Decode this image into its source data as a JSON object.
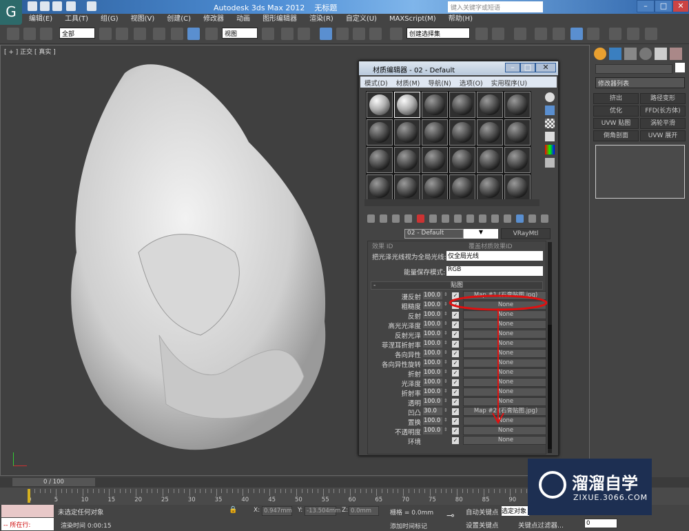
{
  "app": {
    "title": "Autodesk 3ds Max  2012",
    "doc": "无标题",
    "search_placeholder": "键入关键字或短语"
  },
  "menu": [
    "编辑(E)",
    "工具(T)",
    "组(G)",
    "视图(V)",
    "创建(C)",
    "修改器",
    "动画",
    "图形编辑器",
    "渲染(R)",
    "自定义(U)",
    "MAXScript(M)",
    "帮助(H)"
  ],
  "toolbar": {
    "selection_filter": "全部",
    "ref_coord": "视图",
    "named_selection": "创建选择集"
  },
  "viewport": {
    "label": "[ + ] 正交 [ 真实 ]"
  },
  "command_panel": {
    "modifier_list": "修改器列表",
    "buttons": [
      "挤出",
      "路径变形",
      "优化",
      "FFD(长方体)",
      "UVW 贴图",
      "涡轮平滑",
      "倒角剖面",
      "UVW 展开"
    ]
  },
  "material_editor": {
    "title": "材质编辑器 - 02 - Default",
    "menu": [
      "模式(D)",
      "材质(M)",
      "导航(N)",
      "选项(O)",
      "实用程序(U)"
    ],
    "material_name": "02 - Default",
    "material_type": "VRayMtl",
    "effect_id_label": "效果 ID",
    "override_label": "覆盖材质效果ID",
    "gi_label": "把光泽光线视为全局光线:",
    "gi_value": "仅全局光线",
    "energy_label": "能量保存模式:",
    "energy_value": "RGB",
    "maps_rollout": "贴图",
    "maps": [
      {
        "label": "漫反射",
        "amount": "100.0",
        "checked": true,
        "map": "Map #1 (石膏贴图.jpg)"
      },
      {
        "label": "粗糙度",
        "amount": "100.0",
        "checked": true,
        "map": "None"
      },
      {
        "label": "反射",
        "amount": "100.0",
        "checked": true,
        "map": "None"
      },
      {
        "label": "高光光泽度",
        "amount": "100.0",
        "checked": true,
        "map": "None"
      },
      {
        "label": "反射光泽",
        "amount": "100.0",
        "checked": true,
        "map": "None"
      },
      {
        "label": "菲涅耳折射率",
        "amount": "100.0",
        "checked": true,
        "map": "None"
      },
      {
        "label": "各向异性",
        "amount": "100.0",
        "checked": true,
        "map": "None"
      },
      {
        "label": "各向异性旋转",
        "amount": "100.0",
        "checked": true,
        "map": "None"
      },
      {
        "label": "折射",
        "amount": "100.0",
        "checked": true,
        "map": "None"
      },
      {
        "label": "光泽度",
        "amount": "100.0",
        "checked": true,
        "map": "None"
      },
      {
        "label": "折射率",
        "amount": "100.0",
        "checked": true,
        "map": "None"
      },
      {
        "label": "透明",
        "amount": "100.0",
        "checked": true,
        "map": "None"
      },
      {
        "label": "凹凸",
        "amount": "30.0",
        "checked": true,
        "map": "Map #2 (石膏贴图.jpg)"
      },
      {
        "label": "置换",
        "amount": "100.0",
        "checked": true,
        "map": "None"
      },
      {
        "label": "不透明度",
        "amount": "100.0",
        "checked": true,
        "map": "None"
      },
      {
        "label": "环境",
        "amount": "",
        "checked": true,
        "map": "None"
      }
    ],
    "annotation_color": "#e01010"
  },
  "timeline": {
    "frame": "0 / 100",
    "ticks": [
      "0",
      "5",
      "10",
      "15",
      "20",
      "25",
      "30",
      "35",
      "40",
      "45",
      "50",
      "55",
      "60",
      "65",
      "70",
      "75",
      "80",
      "85",
      "90"
    ]
  },
  "status": {
    "selection": "未选定任何对象",
    "render_time": "渲染时间  0:00:15",
    "x": "0.947mm",
    "y": "-13.504mm",
    "z": "0.0mm",
    "grid": "栅格 = 0.0mm",
    "add_time_tag": "添加时间标记",
    "auto_key": "自动关键点",
    "set_key": "设置关键点",
    "key_mode": "选定对象",
    "key_filters": "关键点过滤器...",
    "frame_field": "0",
    "script_label": "所在行:"
  },
  "watermark": {
    "name": "溜溜自学",
    "url": "ZIXUE.3066.COM"
  }
}
